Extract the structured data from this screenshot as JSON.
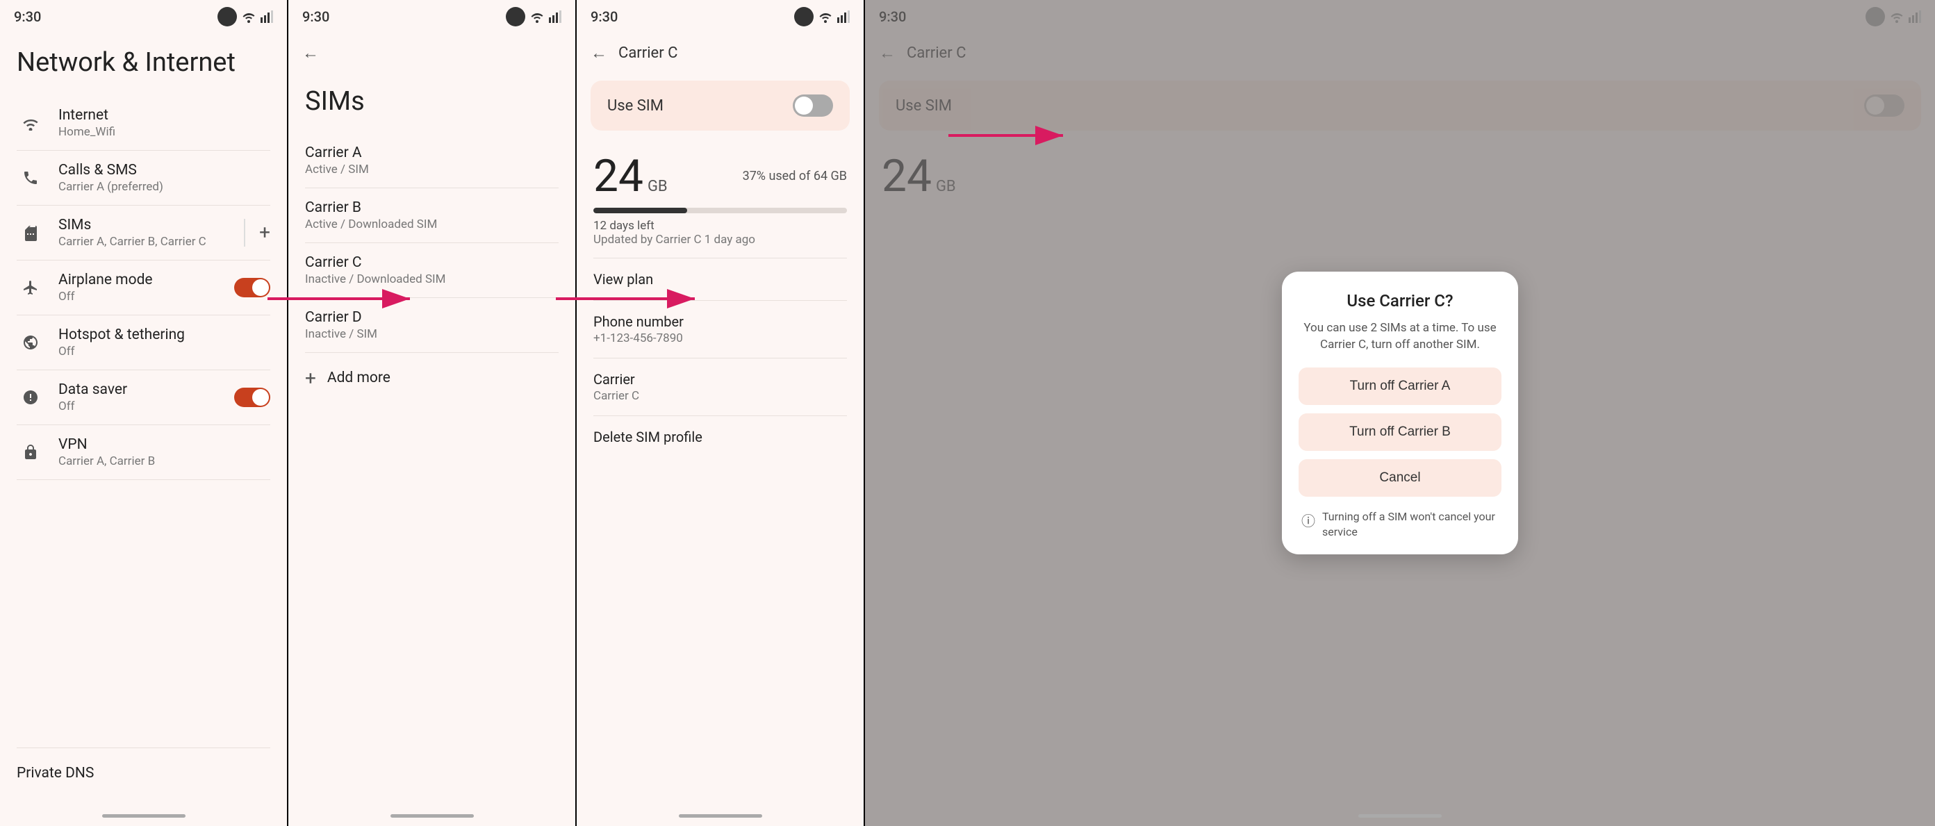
{
  "colors": {
    "bg": "#fdf6f4",
    "accent": "#c8401e",
    "card_bg": "#fce9e2",
    "text_primary": "#222",
    "text_secondary": "#777",
    "progress_fill": "#333",
    "progress_bg": "#e0d8d4"
  },
  "panel1": {
    "status_time": "9:30",
    "page_title": "Network & Internet",
    "menu_items": [
      {
        "icon": "wifi",
        "label": "Internet",
        "sublabel": "Home_Wifi"
      },
      {
        "icon": "phone",
        "label": "Calls & SMS",
        "sublabel": "Carrier A (preferred)"
      },
      {
        "icon": "sim",
        "label": "SIMs",
        "sublabel": "Carrier A, Carrier B, Carrier C",
        "has_divider": true,
        "has_plus": true
      },
      {
        "icon": "airplane",
        "label": "Airplane mode",
        "sublabel": "Off",
        "has_toggle": true,
        "toggle_state": "on"
      },
      {
        "icon": "hotspot",
        "label": "Hotspot & tethering",
        "sublabel": "Off"
      },
      {
        "icon": "data_saver",
        "label": "Data saver",
        "sublabel": "Off",
        "has_toggle": true,
        "toggle_state": "on"
      },
      {
        "icon": "vpn",
        "label": "VPN",
        "sublabel": "Carrier A, Carrier B"
      }
    ],
    "bottom_item": "Private DNS"
  },
  "panel2": {
    "status_time": "9:30",
    "page_title": "SIMs",
    "sim_items": [
      {
        "name": "Carrier A",
        "status": "Active / SIM"
      },
      {
        "name": "Carrier B",
        "status": "Active / Downloaded SIM"
      },
      {
        "name": "Carrier C",
        "status": "Inactive / Downloaded SIM",
        "highlighted": true
      },
      {
        "name": "Carrier D",
        "status": "Inactive / SIM"
      }
    ],
    "add_more_label": "Add more"
  },
  "panel3": {
    "status_time": "9:30",
    "back_title": "Carrier C",
    "use_sim_label": "Use SIM",
    "toggle_state": "off",
    "data_gb": "24",
    "data_unit": "GB",
    "data_percent": "37% used of 64 GB",
    "data_progress": 37,
    "days_left": "12 days left",
    "updated": "Updated by Carrier C 1 day ago",
    "detail_items": [
      {
        "label": "View plan"
      },
      {
        "label": "Phone number",
        "value": "+1-123-456-7890"
      },
      {
        "label": "Carrier",
        "value": "Carrier C"
      }
    ],
    "delete_label": "Delete SIM profile"
  },
  "panel4": {
    "status_time": "9:30",
    "back_title": "Carrier C",
    "use_sim_label": "Use SIM",
    "toggle_state": "off",
    "data_gb": "24",
    "data_unit": "GB",
    "dialog": {
      "title": "Use Carrier C?",
      "description": "You can use 2 SIMs at a time. To use Carrier C, turn off another SIM.",
      "btn1": "Turn off Carrier A",
      "btn2": "Turn off Carrier B",
      "btn3": "Cancel",
      "footer_text": "Turning off a SIM won't cancel your service"
    }
  }
}
